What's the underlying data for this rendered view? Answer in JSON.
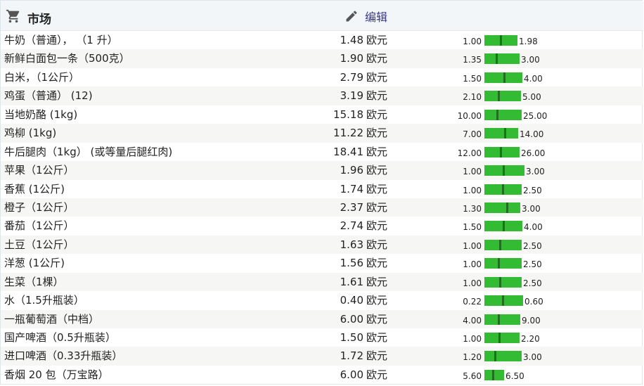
{
  "header": {
    "title": "市场",
    "edit_label": "编辑"
  },
  "currency": "欧元",
  "items": [
    {
      "name": "牛奶（普通）， （1 升）",
      "price": "1.48",
      "min": "1.00",
      "max": "1.98"
    },
    {
      "name": "新鲜白面包一条（500克）",
      "price": "1.90",
      "min": "1.35",
      "max": "3.00"
    },
    {
      "name": "白米，（1公斤）",
      "price": "2.79",
      "min": "1.50",
      "max": "4.00"
    },
    {
      "name": "鸡蛋（普通） (12)",
      "price": "3.19",
      "min": "2.10",
      "max": "5.00"
    },
    {
      "name": "当地奶酪 (1kg)",
      "price": "15.18",
      "min": "10.00",
      "max": "25.00"
    },
    {
      "name": "鸡柳 (1kg)",
      "price": "11.22",
      "min": "7.00",
      "max": "14.00"
    },
    {
      "name": "牛后腿肉（1kg） (或等量后腿红肉)",
      "price": "18.41",
      "min": "12.00",
      "max": "26.00"
    },
    {
      "name": "苹果（1公斤）",
      "price": "1.96",
      "min": "1.00",
      "max": "3.00"
    },
    {
      "name": "香蕉 (1公斤)",
      "price": "1.74",
      "min": "1.00",
      "max": "2.50"
    },
    {
      "name": "橙子（1公斤）",
      "price": "2.37",
      "min": "1.30",
      "max": "3.00"
    },
    {
      "name": "番茄（1公斤）",
      "price": "2.74",
      "min": "1.50",
      "max": "4.00"
    },
    {
      "name": "土豆（1公斤）",
      "price": "1.63",
      "min": "1.00",
      "max": "2.50"
    },
    {
      "name": "洋葱 (1公斤)",
      "price": "1.56",
      "min": "1.00",
      "max": "2.50"
    },
    {
      "name": "生菜（1棵）",
      "price": "1.61",
      "min": "1.00",
      "max": "2.50"
    },
    {
      "name": "水（1.5升瓶装）",
      "price": "0.40",
      "min": "0.22",
      "max": "0.60"
    },
    {
      "name": "一瓶葡萄酒（中档）",
      "price": "6.00",
      "min": "4.00",
      "max": "9.00"
    },
    {
      "name": "国产啤酒（0.5升瓶装）",
      "price": "1.50",
      "min": "1.00",
      "max": "2.20"
    },
    {
      "name": "进口啤酒（0.33升瓶装）",
      "price": "1.72",
      "min": "1.20",
      "max": "3.00"
    },
    {
      "name": "香烟 20 包（万宝路）",
      "price": "6.00",
      "min": "5.60",
      "max": "6.50"
    }
  ]
}
